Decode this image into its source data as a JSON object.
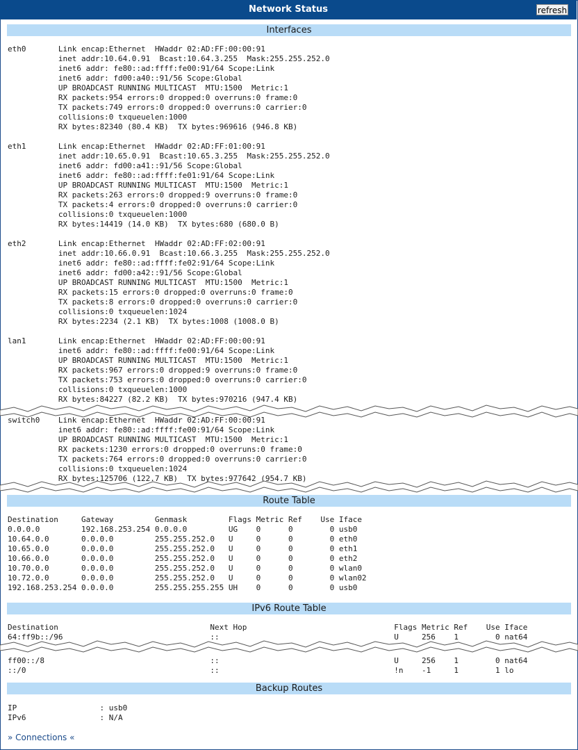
{
  "window": {
    "title": "Network Status",
    "refresh_label": "refresh"
  },
  "sections": {
    "interfaces": "Interfaces",
    "route_table": "Route Table",
    "ipv6_route_table": "IPv6 Route Table",
    "backup_routes": "Backup Routes"
  },
  "interfaces": {
    "block1": "eth0       Link encap:Ethernet  HWaddr 02:AD:FF:00:00:91\n           inet addr:10.64.0.91  Bcast:10.64.3.255  Mask:255.255.252.0\n           inet6 addr: fe80::ad:ffff:fe00:91/64 Scope:Link\n           inet6 addr: fd00:a40::91/56 Scope:Global\n           UP BROADCAST RUNNING MULTICAST  MTU:1500  Metric:1\n           RX packets:954 errors:0 dropped:0 overruns:0 frame:0\n           TX packets:749 errors:0 dropped:0 overruns:0 carrier:0\n           collisions:0 txqueuelen:1000\n           RX bytes:82340 (80.4 KB)  TX bytes:969616 (946.8 KB)\n\neth1       Link encap:Ethernet  HWaddr 02:AD:FF:01:00:91\n           inet addr:10.65.0.91  Bcast:10.65.3.255  Mask:255.255.252.0\n           inet6 addr: fd00:a41::91/56 Scope:Global\n           inet6 addr: fe80::ad:ffff:fe01:91/64 Scope:Link\n           UP BROADCAST RUNNING MULTICAST  MTU:1500  Metric:1\n           RX packets:263 errors:0 dropped:9 overruns:0 frame:0\n           TX packets:4 errors:0 dropped:0 overruns:0 carrier:0\n           collisions:0 txqueuelen:1000\n           RX bytes:14419 (14.0 KB)  TX bytes:680 (680.0 B)\n\neth2       Link encap:Ethernet  HWaddr 02:AD:FF:02:00:91\n           inet addr:10.66.0.91  Bcast:10.66.3.255  Mask:255.255.252.0\n           inet6 addr: fe80::ad:ffff:fe02:91/64 Scope:Link\n           inet6 addr: fd00:a42::91/56 Scope:Global\n           UP BROADCAST RUNNING MULTICAST  MTU:1500  Metric:1\n           RX packets:15 errors:0 dropped:0 overruns:0 frame:0\n           TX packets:8 errors:0 dropped:0 overruns:0 carrier:0\n           collisions:0 txqueuelen:1024\n           RX bytes:2234 (2.1 KB)  TX bytes:1008 (1008.0 B)\n\nlan1       Link encap:Ethernet  HWaddr 02:AD:FF:00:00:91\n           inet6 addr: fe80::ad:ffff:fe00:91/64 Scope:Link\n           UP BROADCAST RUNNING MULTICAST  MTU:1500  Metric:1\n           RX packets:967 errors:0 dropped:9 overruns:0 frame:0\n           TX packets:753 errors:0 dropped:0 overruns:0 carrier:0\n           collisions:0 txqueuelen:1000\n           RX bytes:84227 (82.2 KB)  TX bytes:970216 (947.4 KB)",
    "block2": "switch0    Link encap:Ethernet  HWaddr 02:AD:FF:00:00:91\n           inet6 addr: fe80::ad:ffff:fe00:91/64 Scope:Link\n           UP BROADCAST RUNNING MULTICAST  MTU:1500  Metric:1\n           RX packets:1230 errors:0 dropped:0 overruns:0 frame:0\n           TX packets:764 errors:0 dropped:0 overruns:0 carrier:0\n           collisions:0 txqueuelen:1024\n           RX bytes:125706 (122.7 KB)  TX bytes:977642 (954.7 KB)"
  },
  "route_table": "Destination     Gateway         Genmask         Flags Metric Ref    Use Iface\n0.0.0.0         192.168.253.254 0.0.0.0         UG    0      0        0 usb0\n10.64.0.0       0.0.0.0         255.255.252.0   U     0      0        0 eth0\n10.65.0.0       0.0.0.0         255.255.252.0   U     0      0        0 eth1\n10.66.0.0       0.0.0.0         255.255.252.0   U     0      0        0 eth2\n10.70.0.0       0.0.0.0         255.255.252.0   U     0      0        0 wlan0\n10.72.0.0       0.0.0.0         255.255.252.0   U     0      0        0 wlan02\n192.168.253.254 0.0.0.0         255.255.255.255 UH    0      0        0 usb0",
  "ipv6_routes": {
    "block1": "Destination                                 Next Hop                                Flags Metric Ref    Use Iface\n64:ff9b::/96                                ::                                      U     256    1        0 nat64",
    "block2": "ff00::/8                                    ::                                      U     256    1        0 nat64\n::/0                                        ::                                      !n    -1     1        1 lo"
  },
  "backup_routes": "IP                  : usb0\nIPv6                : N/A",
  "connections_link": "» Connections «",
  "colors": {
    "title_bar": "#0a4a8c",
    "section_header": "#b9dcf7",
    "text": "#1a1a1a",
    "link": "#1a4a8a"
  }
}
